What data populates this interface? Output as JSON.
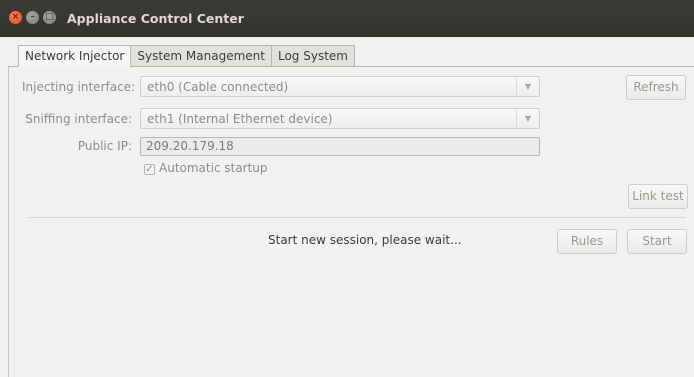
{
  "window": {
    "title": "Appliance Control Center",
    "close_glyph": "×",
    "minimize_glyph": "–",
    "maximize_glyph": "□"
  },
  "tabs": [
    {
      "label": "Network Injector",
      "active": true
    },
    {
      "label": "System Management",
      "active": false
    },
    {
      "label": "Log System",
      "active": false
    }
  ],
  "form": {
    "injecting_label": "Injecting interface:",
    "injecting_value": "eth0 (Cable connected)",
    "sniffing_label": "Sniffing interface:",
    "sniffing_value": "eth1 (Internal Ethernet device)",
    "public_ip_label": "Public IP:",
    "public_ip_value": "209.20.179.18",
    "auto_startup_label": "Automatic startup",
    "auto_startup_checked": true,
    "check_glyph": "✓",
    "dropdown_glyph": "▼"
  },
  "buttons": {
    "refresh": "Refresh",
    "link_test": "Link test",
    "rules": "Rules",
    "start": "Start"
  },
  "status": {
    "message": "Start new session, please wait..."
  },
  "icons": {
    "close": "close-icon",
    "minimize": "minimize-icon",
    "maximize": "maximize-icon",
    "dropdown": "chevron-down-icon",
    "check": "checkmark-icon"
  }
}
